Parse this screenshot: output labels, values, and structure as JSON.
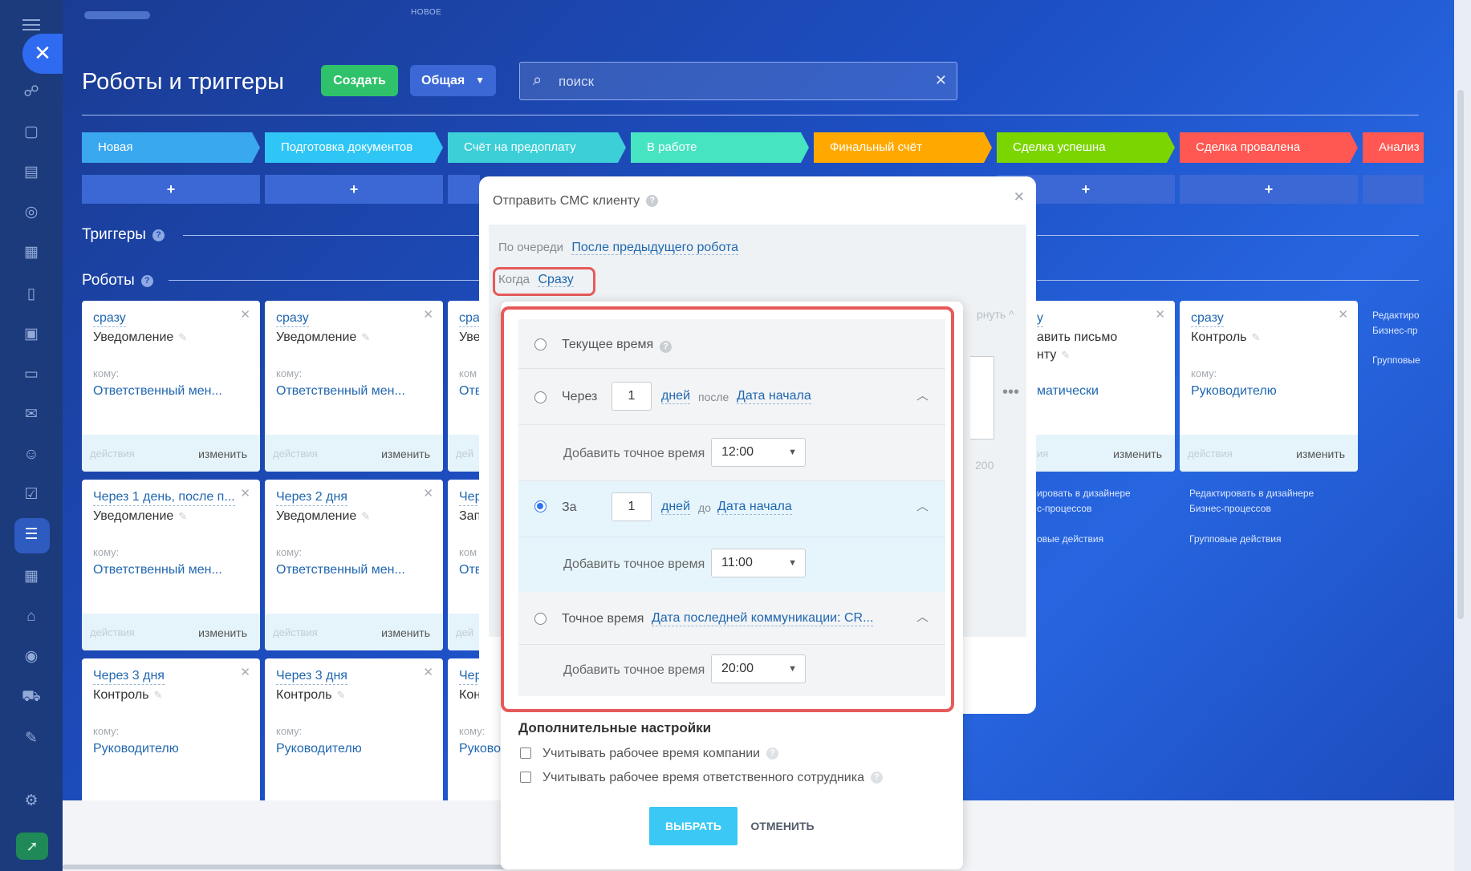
{
  "header": {
    "new_badge": "НОВОЕ",
    "title": "Роботы и триггеры",
    "create_label": "Создать",
    "general_label": "Общая",
    "search_placeholder": "поиск"
  },
  "stages": [
    {
      "label": "Новая",
      "color": "#39a8ef"
    },
    {
      "label": "Подготовка документов",
      "color": "#2fc6f6"
    },
    {
      "label": "Счёт на предоплату",
      "color": "#3ccfd8"
    },
    {
      "label": "В работе",
      "color": "#47e4c2"
    },
    {
      "label": "Финальный счёт",
      "color": "#ffa900"
    },
    {
      "label": "Сделка успешна",
      "color": "#7bd500"
    },
    {
      "label": "Сделка провалена",
      "color": "#ff5752"
    },
    {
      "label": "Анализ",
      "color": "#ff5752"
    }
  ],
  "plus_label": "+",
  "sections": {
    "triggers": "Триггеры",
    "robots": "Роботы"
  },
  "cards": {
    "r1c1": {
      "when": "сразу",
      "title": "Уведомление",
      "to_label": "кому:",
      "recipient": "Ответственный мен...",
      "actions": "действия",
      "edit": "изменить"
    },
    "r1c2": {
      "when": "сразу",
      "title": "Уведомление",
      "to_label": "кому:",
      "recipient": "Ответственный мен...",
      "actions": "действия",
      "edit": "изменить"
    },
    "r1c3": {
      "when": "сра",
      "title": "Уве",
      "to_label": "ком",
      "recipient": "Отв",
      "actions": "дей"
    },
    "r2c1": {
      "when": "Через 1 день, после п...",
      "title": "Уведомление",
      "to_label": "кому:",
      "recipient": "Ответственный мен...",
      "actions": "действия",
      "edit": "изменить"
    },
    "r2c2": {
      "when": "Через 2 дня",
      "title": "Уведомление",
      "to_label": "кому:",
      "recipient": "Ответственный мен...",
      "actions": "действия",
      "edit": "изменить"
    },
    "r2c3": {
      "when": "Чер",
      "title": "Зап",
      "to_label": "ком",
      "recipient": "Отв",
      "actions": "дей"
    },
    "r3c1": {
      "when": "Через 3 дня",
      "title": "Контроль",
      "to_label": "кому:",
      "recipient": "Руководителю"
    },
    "r3c2": {
      "when": "Через 3 дня",
      "title": "Контроль",
      "to_label": "кому:",
      "recipient": "Руководителю"
    },
    "r3c3": {
      "when": "Чер",
      "title": "Кон",
      "to_label": "кому:",
      "recipient": "Руково"
    },
    "r1c6": {
      "when": "у",
      "title_1": "авить письмо",
      "title_2": "нту",
      "recipient": "матически",
      "actions": "ия",
      "edit": "изменить"
    },
    "r1c7": {
      "when": "сразу",
      "title": "Контроль",
      "to_label": "кому:",
      "recipient": "Руководителю",
      "actions": "действия",
      "edit": "изменить"
    }
  },
  "side_notes": {
    "col8_line1": "Редактиро",
    "col8_line2": "Бизнес-пр",
    "col8_line3": "Групповые",
    "col6_line1": "ировать в дизайнере",
    "col6_line2": "с-процессов",
    "col6_line3": "овые действия",
    "col7_line1": "Редактировать в дизайнере",
    "col7_line2": "Бизнес-процессов",
    "col7_line3": "Групповые действия"
  },
  "dialog": {
    "title": "Отправить СМС клиенту",
    "order_label": "По очереди",
    "order_value": "После предыдущего робота",
    "when_label": "Когда",
    "when_value": "Сразу",
    "ghost_collapse": "рнуть",
    "ghost_number": "200"
  },
  "timing": {
    "current_time": "Текущее время",
    "after": {
      "label": "Через",
      "value": "1",
      "unit": "дней",
      "rel": "после",
      "field": "Дата начала",
      "exact_label": "Добавить точное время",
      "time": "12:00"
    },
    "before": {
      "label": "За",
      "value": "1",
      "unit": "дней",
      "rel": "до",
      "field": "Дата начала",
      "exact_label": "Добавить точное время",
      "time": "11:00"
    },
    "exact": {
      "label": "Точное время",
      "field": "Дата последней коммуникации: CR...",
      "exact_label": "Добавить точное время",
      "time": "20:00"
    },
    "selected": "before"
  },
  "extra": {
    "title": "Дополнительные настройки",
    "opt1": "Учитывать рабочее время компании",
    "opt2": "Учитывать рабочее время ответственного сотрудника"
  },
  "buttons": {
    "select": "ВЫБРАТЬ",
    "cancel": "ОТМЕНИТЬ"
  },
  "colors": {
    "highlight": "#e65a5a",
    "link": "#2067b0",
    "primary": "#3bc8f5",
    "accent_radio": "#2d74f0"
  }
}
